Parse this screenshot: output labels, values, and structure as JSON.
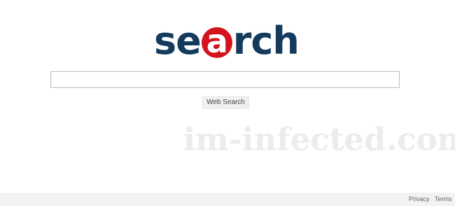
{
  "logo": {
    "part1": "se",
    "part2": "a",
    "part3": "rch",
    "colors": {
      "text": "#143a5c",
      "accent": "#d4141c"
    }
  },
  "search": {
    "value": "",
    "placeholder": ""
  },
  "button": {
    "label": "Web Search"
  },
  "watermark": {
    "text": "im-infected.com"
  },
  "footer": {
    "privacy": "Privacy",
    "terms": "Terms"
  }
}
